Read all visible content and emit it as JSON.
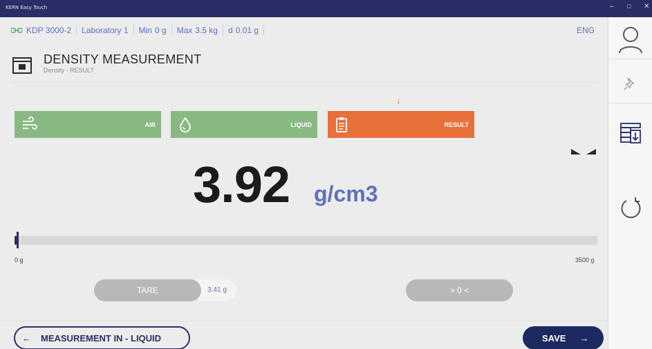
{
  "window": {
    "title": "KERN Easy Touch"
  },
  "info": {
    "device": "KDP 3000-2",
    "location": "Laboratory 1",
    "min_label": "Min",
    "min_value": "0 g",
    "max_label": "Max",
    "max_value": "3.5 kg",
    "d_label": "d",
    "d_value": "0.01 g",
    "language": "ENG"
  },
  "header": {
    "title": "DENSITY MEASUREMENT",
    "subtitle": "Density - RESULT"
  },
  "steps": [
    {
      "label": "AIR",
      "icon": "air-flow-icon",
      "state": "done"
    },
    {
      "label": "LIQUID",
      "icon": "liquid-drop-icon",
      "state": "done"
    },
    {
      "label": "RESULT",
      "icon": "clipboard-icon",
      "state": "active"
    }
  ],
  "colors": {
    "accent": "#6070bf",
    "dark": "#2b2e66",
    "done": "#88b982",
    "active": "#e8703a"
  },
  "reading": {
    "value": "3.92",
    "unit": "g/cm3"
  },
  "capacity": {
    "min": "0 g",
    "max": "3500 g",
    "fill_fraction": 0.004
  },
  "tare": {
    "label": "TARE",
    "value": "3.41 g"
  },
  "zero": {
    "label": "> 0 <"
  },
  "footer": {
    "back_label": "MEASUREMENT IN - LIQUID",
    "save_label": "SAVE"
  },
  "side_icons": [
    "user-icon",
    "pin-icon",
    "data-export-icon",
    "refresh-icon"
  ]
}
